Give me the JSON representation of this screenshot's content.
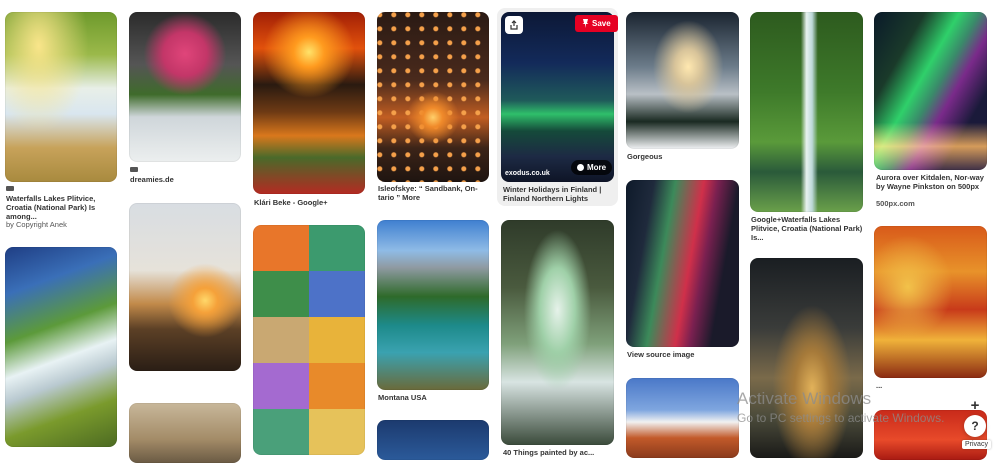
{
  "pins": [
    {
      "id": "waterfalls-plitvice",
      "caption": "Waterfalls Lakes Plitvice, Croatia (National Park) Is among...",
      "credit": "by Copyright Anek"
    },
    {
      "id": "dreamies",
      "caption": "dreamies.de"
    },
    {
      "id": "klari-beke",
      "caption": "Klári Beke - Google+"
    },
    {
      "id": "isleofskye",
      "caption": "Isleofskye: “ Sandbank, On-tario ” More"
    },
    {
      "id": "winter-holidays",
      "caption": "Winter Holidays in Finland | Finland Northern Lights",
      "source": "exodus.co.uk"
    },
    {
      "id": "gorgeous",
      "caption": "Gorgeous"
    },
    {
      "id": "google-waterfalls",
      "caption": "Google+Waterfalls Lakes Plitvice, Croatia (National Park) Is..."
    },
    {
      "id": "aurora-kitdalen",
      "caption": "Aurora over Kitdalen, Nor-way by Wayne Pinkston on 500px",
      "credit": "500px.com"
    },
    {
      "id": "montana",
      "caption": "Montana USA"
    },
    {
      "id": "view-source",
      "caption": "View source image"
    },
    {
      "id": "things-cave",
      "caption": "40 Things painted by ac..."
    },
    {
      "id": "autumn",
      "caption": "..."
    }
  ],
  "buttons": {
    "save": "Save",
    "more": "More",
    "plus": "+",
    "help": "?",
    "privacy": "Privacy"
  },
  "watermark": {
    "title": "Activate Windows",
    "subtitle": "Go to PC settings to activate Windows."
  },
  "icons": [
    "pin-icon",
    "share-icon",
    "more-dot-icon",
    "plus-icon",
    "help-icon"
  ]
}
